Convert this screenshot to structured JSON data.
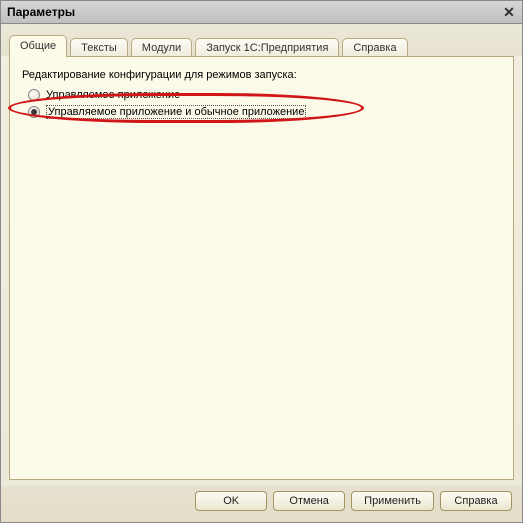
{
  "window": {
    "title": "Параметры"
  },
  "close_glyph": "✕",
  "tabs": [
    {
      "label": "Общие",
      "active": true
    },
    {
      "label": "Тексты",
      "active": false
    },
    {
      "label": "Модули",
      "active": false
    },
    {
      "label": "Запуск 1С:Предприятия",
      "active": false
    },
    {
      "label": "Справка",
      "active": false
    }
  ],
  "heading": "Редактирование конфигурации для режимов запуска:",
  "options": [
    {
      "label": "Управляемое приложение",
      "checked": false
    },
    {
      "label": "Управляемое приложение и обычное приложение",
      "checked": true
    }
  ],
  "buttons": {
    "ok": "OK",
    "cancel": "Отмена",
    "apply": "Применить",
    "help": "Справка"
  }
}
